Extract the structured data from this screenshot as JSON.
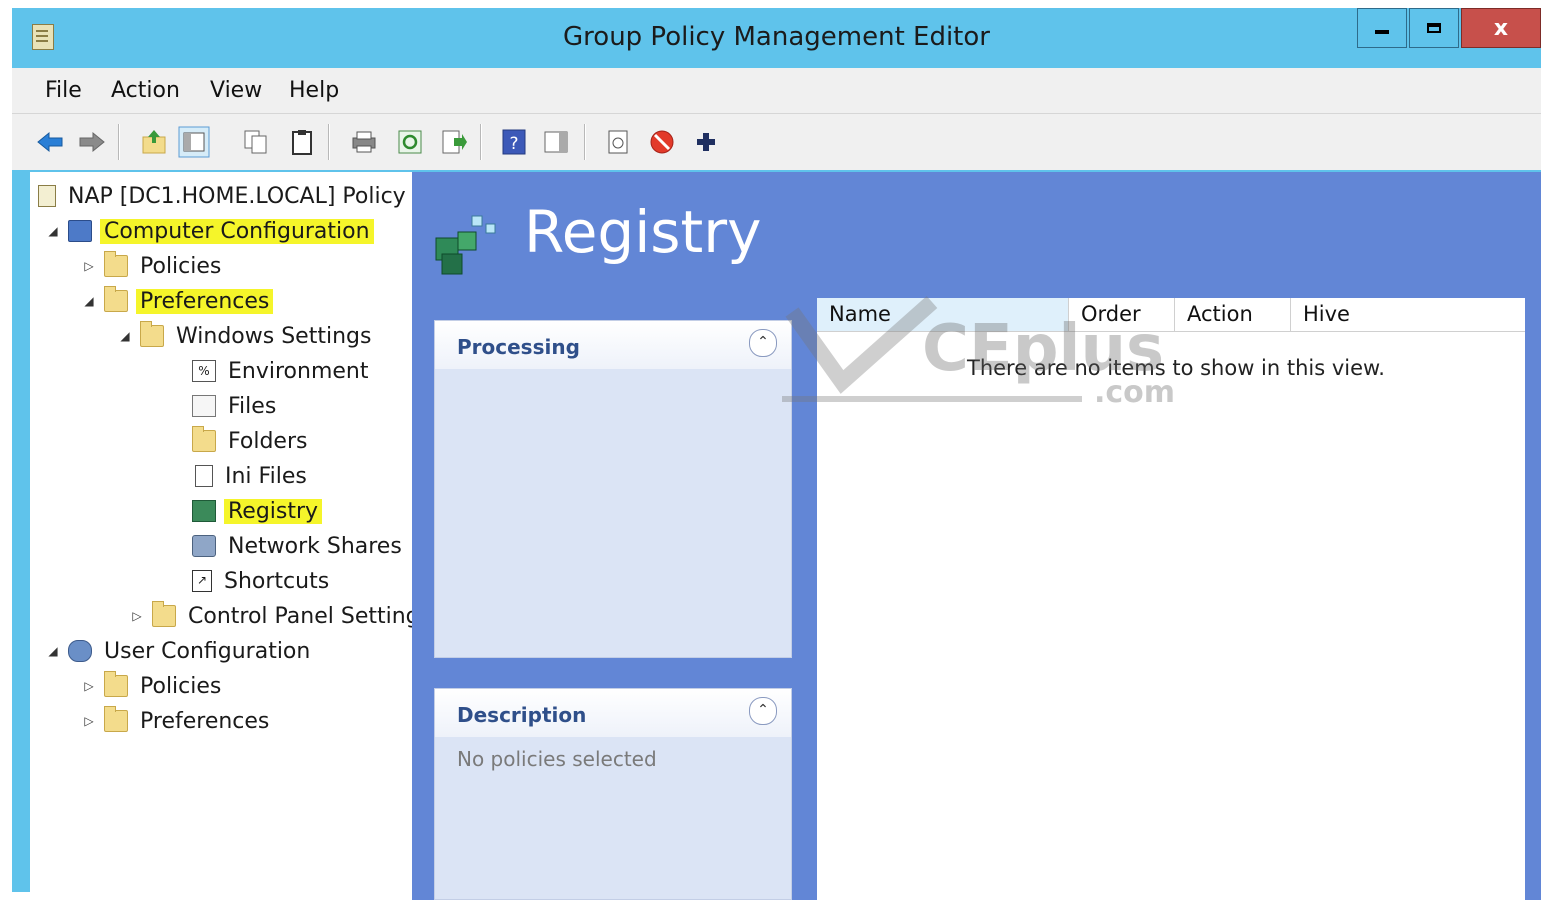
{
  "window": {
    "title": "Group Policy Management Editor",
    "controls": [
      "minimize-icon",
      "maximize-icon",
      "close-icon"
    ],
    "close_glyph": "x"
  },
  "menu": {
    "items": [
      {
        "label": "File"
      },
      {
        "label": "Action"
      },
      {
        "label": "View"
      },
      {
        "label": "Help"
      }
    ]
  },
  "toolbar": {
    "icons": [
      "back-arrow-icon",
      "forward-arrow-icon",
      "up-folder-icon",
      "show-hide-tree-icon",
      "copy-icon",
      "paste-icon",
      "print-icon",
      "refresh-icon",
      "export-list-icon",
      "help-icon",
      "show-hide-action-pane-icon",
      "xml-icon",
      "disable-icon",
      "add-icon"
    ]
  },
  "tree": {
    "root": "NAP [DC1.HOME.LOCAL] Policy",
    "nodes": [
      {
        "label": "Computer Configuration",
        "highlighted": true,
        "expander": "expanded"
      },
      {
        "label": "Policies",
        "expander": "collapsed"
      },
      {
        "label": "Preferences",
        "highlighted": true,
        "expander": "expanded"
      },
      {
        "label": "Windows Settings",
        "expander": "expanded"
      },
      {
        "label": "Environment"
      },
      {
        "label": "Files"
      },
      {
        "label": "Folders"
      },
      {
        "label": "Ini Files"
      },
      {
        "label": "Registry",
        "highlighted": true
      },
      {
        "label": "Network Shares"
      },
      {
        "label": "Shortcuts"
      },
      {
        "label": "Control Panel Settings",
        "expander": "collapsed"
      },
      {
        "label": "User Configuration",
        "expander": "expanded"
      },
      {
        "label": "Policies",
        "expander": "collapsed"
      },
      {
        "label": "Preferences",
        "expander": "collapsed"
      }
    ],
    "highlight_color": "#f5f52a"
  },
  "content": {
    "heading": "Registry",
    "processing": {
      "title": "Processing"
    },
    "description": {
      "title": "Description",
      "text": "No policies selected"
    },
    "columns": [
      "Name",
      "Order",
      "Action",
      "Hive"
    ],
    "empty_message": "There are no items to show in this view."
  },
  "watermark": {
    "text": "CEplus",
    "suffix": ".com"
  },
  "colors": {
    "title_bar": "#5fc3eb",
    "pane_bg": "#6286d6",
    "close_btn": "#c7504b"
  }
}
